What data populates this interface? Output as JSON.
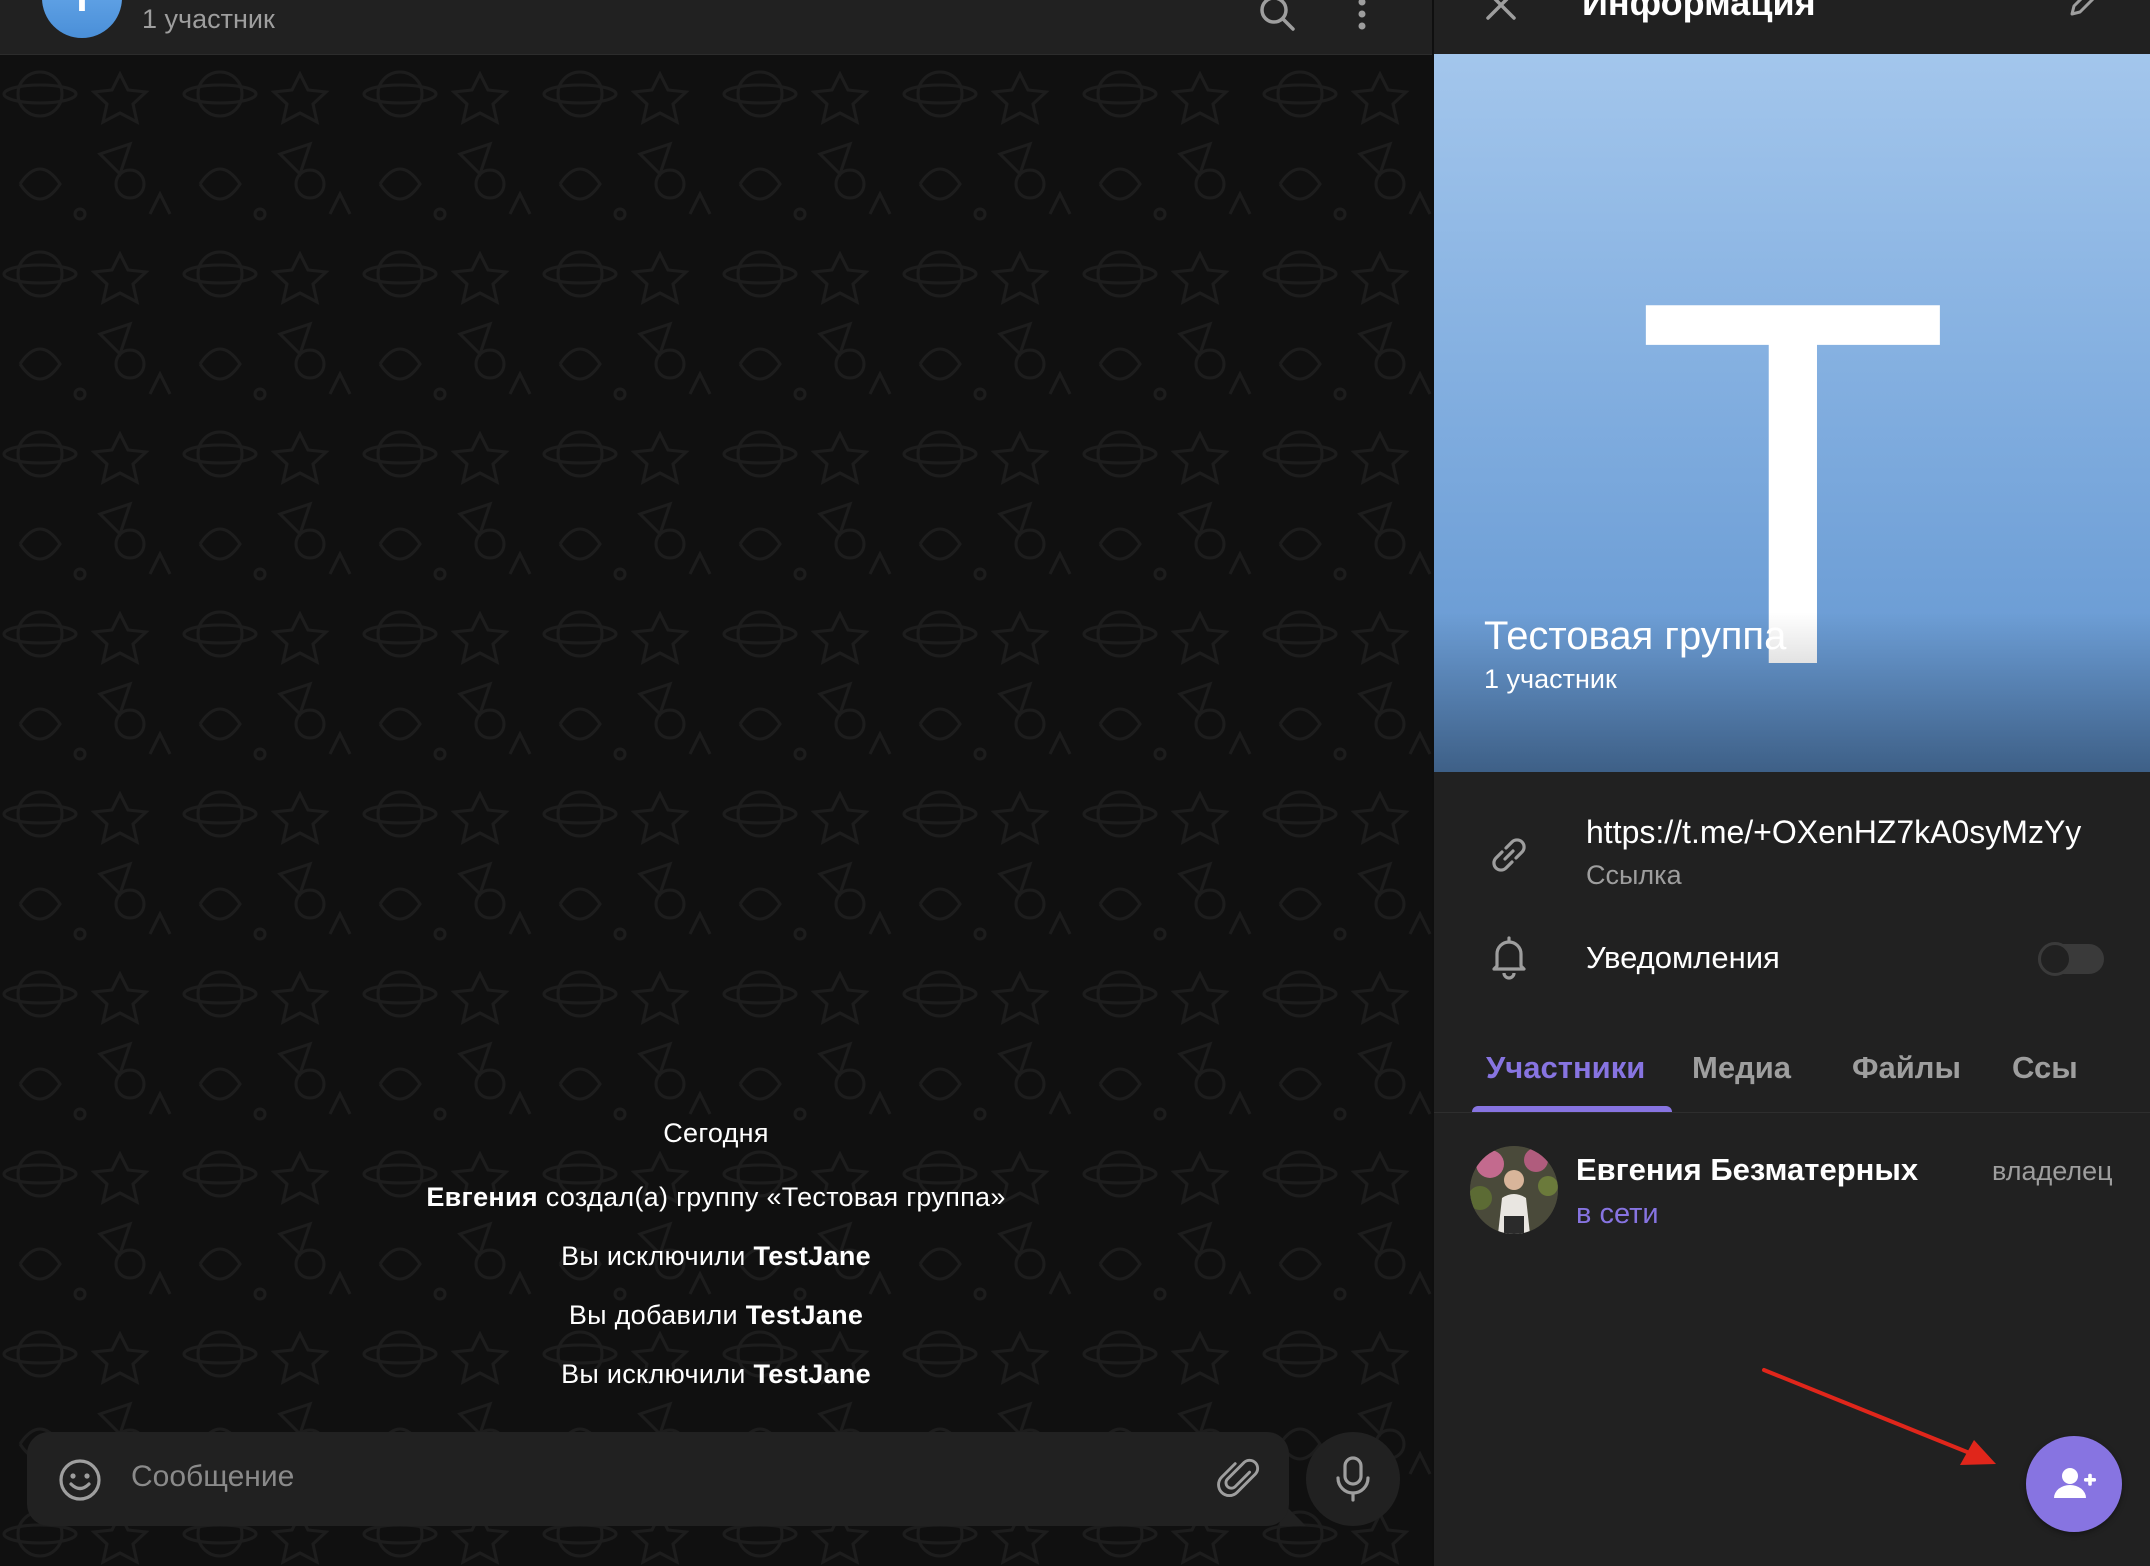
{
  "colors": {
    "accent": "#8774e1",
    "background": "#101010",
    "panel": "#212121",
    "annotation_arrow": "#e0261b"
  },
  "chat": {
    "avatar_letter": "Т",
    "subtitle": "1 участник",
    "header_icons": [
      "search-icon",
      "more-vertical-icon"
    ],
    "date_separator": "Сегодня",
    "service_messages": [
      {
        "actor": "Евгения",
        "text": " создал(а) группу «Тестовая группа»"
      },
      {
        "prefix": "Вы исключили ",
        "target": "TestJane"
      },
      {
        "prefix": "Вы добавили ",
        "target": "TestJane"
      },
      {
        "prefix": "Вы исключили ",
        "target": "TestJane"
      }
    ],
    "composer": {
      "placeholder": "Сообщение",
      "icons": [
        "smile-icon",
        "paperclip-icon",
        "microphone-icon"
      ]
    }
  },
  "info": {
    "title": "Информация",
    "header_icons": [
      "close-icon",
      "pencil-icon"
    ],
    "hero": {
      "letter": "Т",
      "name": "Тестовая группа",
      "members": "1 участник"
    },
    "link": {
      "url": "https://t.me/+OXenHZ7kA0syMzYy",
      "label": "Ссылка"
    },
    "notifications": {
      "label": "Уведомления",
      "enabled": false
    },
    "tabs": [
      "Участники",
      "Медиа",
      "Файлы",
      "Ссы"
    ],
    "active_tab": "Участники",
    "members": [
      {
        "name": "Евгения Безматерных",
        "status": "в сети",
        "role": "владелец"
      }
    ],
    "fab_icon": "add-user-icon"
  }
}
